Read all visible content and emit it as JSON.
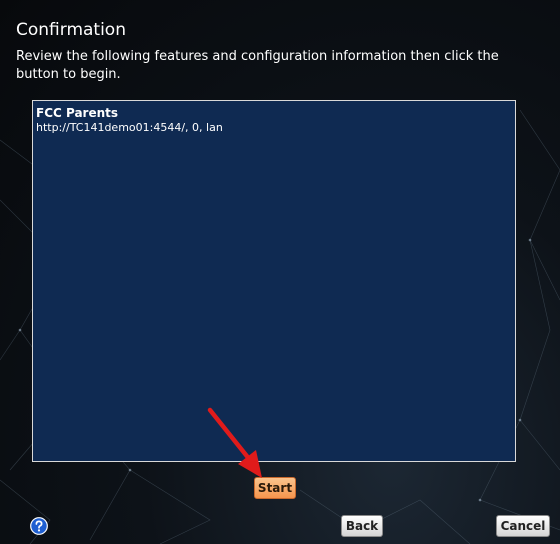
{
  "page": {
    "title": "Confirmation",
    "instructions": "Review the following features and configuration information then click the button to begin."
  },
  "summary": {
    "items": [
      {
        "name": "FCC Parents",
        "detail": "http://TC141demo01:4544/, 0, lan"
      }
    ]
  },
  "buttons": {
    "start_label": "Start",
    "back_label": "Back",
    "cancel_label": "Cancel"
  },
  "icons": {
    "help": "help-icon",
    "annotation": "red-arrow-icon"
  },
  "colors": {
    "panel_bg": "#0f2a52",
    "start_button": "#f5954d",
    "help_icon": "#1f5fd1",
    "annotation_arrow": "#e01b1b"
  }
}
